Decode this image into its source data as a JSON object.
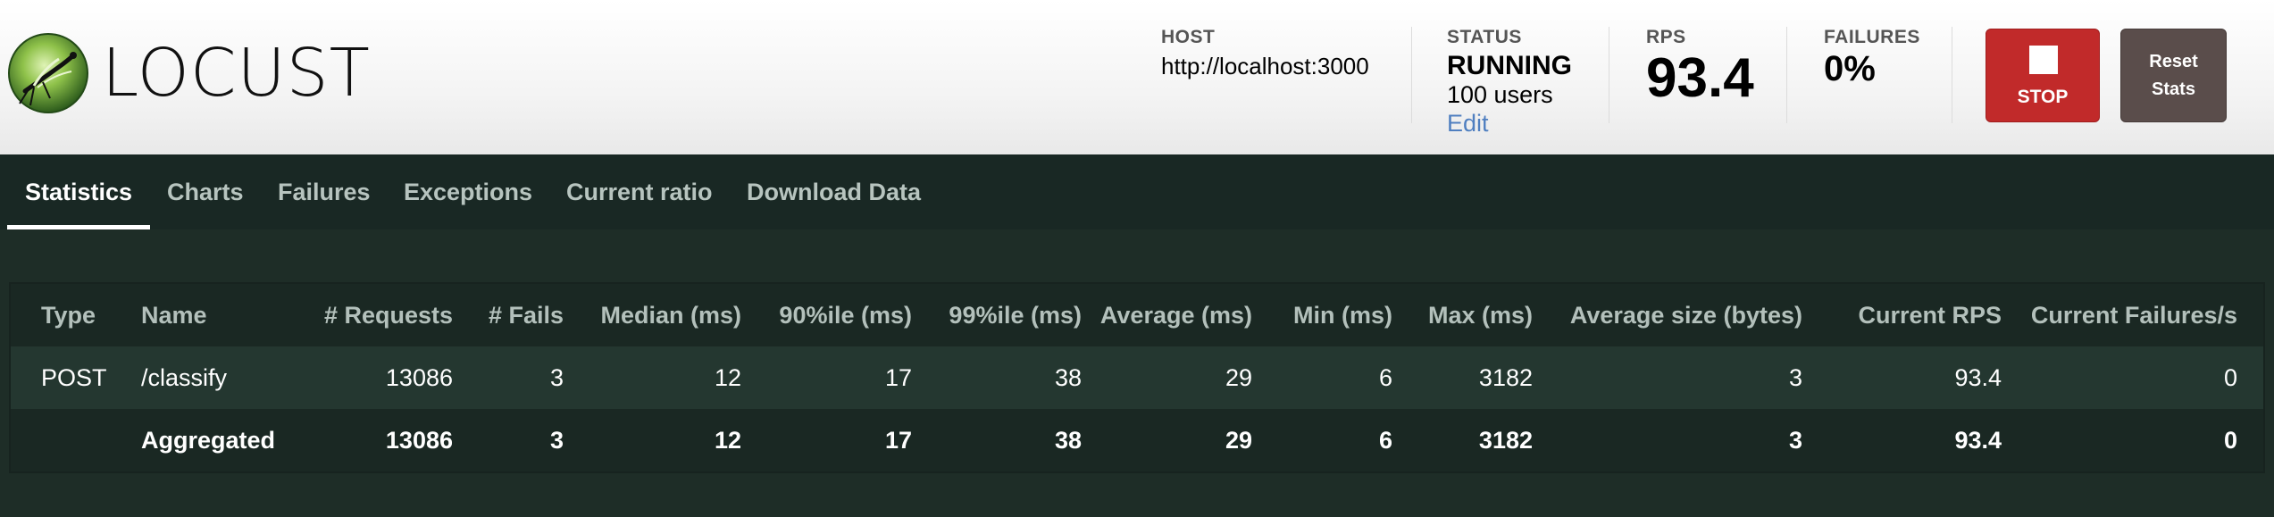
{
  "app": {
    "logo_text": "LOCUST"
  },
  "header": {
    "host": {
      "label": "HOST",
      "value": "http://localhost:3000"
    },
    "status": {
      "label": "STATUS",
      "value": "RUNNING",
      "users": "100 users",
      "edit_label": "Edit"
    },
    "rps": {
      "label": "RPS",
      "value": "93.4"
    },
    "failures": {
      "label": "FAILURES",
      "value": "0%"
    },
    "stop_label": "STOP",
    "reset_line1": "Reset",
    "reset_line2": "Stats"
  },
  "tabs": [
    {
      "label": "Statistics",
      "active": true
    },
    {
      "label": "Charts"
    },
    {
      "label": "Failures"
    },
    {
      "label": "Exceptions"
    },
    {
      "label": "Current ratio"
    },
    {
      "label": "Download Data"
    }
  ],
  "table": {
    "columns": [
      "Type",
      "Name",
      "# Requests",
      "# Fails",
      "Median (ms)",
      "90%ile (ms)",
      "99%ile (ms)",
      "Average (ms)",
      "Min (ms)",
      "Max (ms)",
      "Average size (bytes)",
      "Current RPS",
      "Current Failures/s"
    ],
    "rows": [
      [
        "POST",
        "/classify",
        "13086",
        "3",
        "12",
        "17",
        "38",
        "29",
        "6",
        "3182",
        "3",
        "93.4",
        "0"
      ]
    ],
    "aggregated": [
      "",
      "Aggregated",
      "13086",
      "3",
      "12",
      "17",
      "38",
      "29",
      "6",
      "3182",
      "3",
      "93.4",
      "0"
    ]
  },
  "colors": {
    "stop_button": "#c12a2a",
    "reset_button": "#5a4d4b",
    "background": "#1e2d27",
    "link": "#4f7fc0"
  }
}
